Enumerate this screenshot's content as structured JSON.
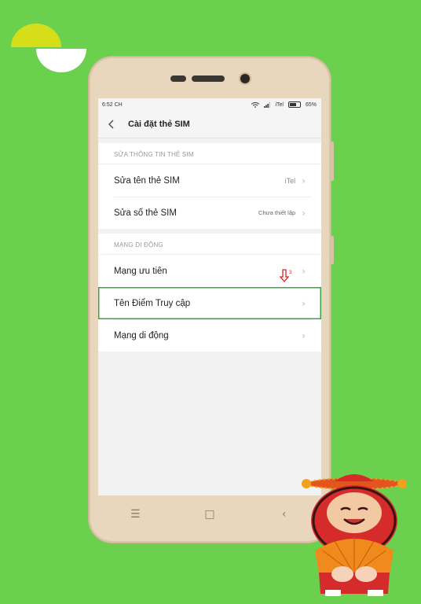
{
  "statusbar": {
    "time": "6:52 CH",
    "carrier": "iTel",
    "battery": "65%"
  },
  "header": {
    "title": "Cài đặt thẻ SIM"
  },
  "sections": [
    {
      "header": "SỬA THÔNG TIN THẺ SIM",
      "rows": [
        {
          "label": "Sửa tên thẻ SIM",
          "value": "iTel"
        },
        {
          "label": "Sửa số thẻ SIM",
          "value": "Chưa thiết lập"
        }
      ]
    },
    {
      "header": "MẠNG DI ĐỘNG",
      "rows": [
        {
          "label": "Mạng ưu tiên",
          "value": ""
        },
        {
          "label": "Tên Điểm Truy cập",
          "value": ""
        },
        {
          "label": "Mạng di động",
          "value": ""
        }
      ]
    }
  ],
  "annotation": {
    "step": "3",
    "color": "#e02020"
  },
  "highlight_color": "#3ba640",
  "navbar": {
    "menu_icon": "☰",
    "home_icon": "□",
    "back_icon": "‹"
  }
}
